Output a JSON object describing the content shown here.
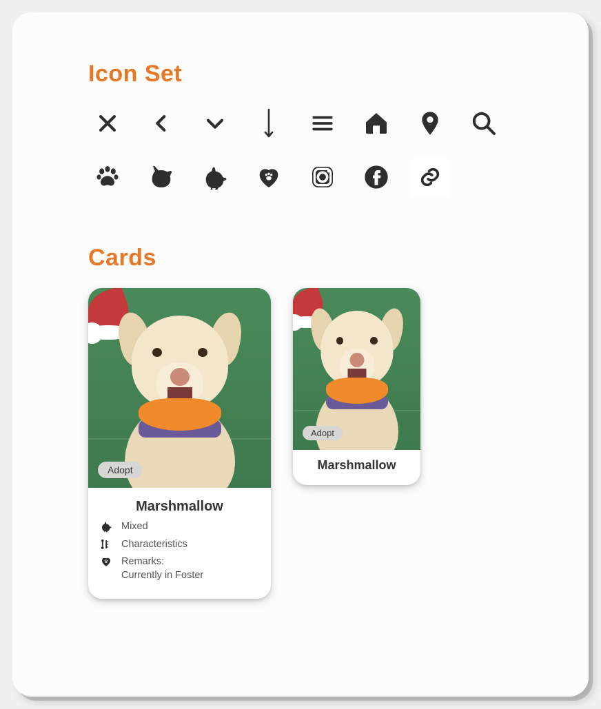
{
  "sections": {
    "icons_title": "Icon Set",
    "cards_title": "Cards"
  },
  "icons": [
    {
      "name": "close-icon"
    },
    {
      "name": "chevron-left-icon"
    },
    {
      "name": "chevron-down-icon"
    },
    {
      "name": "arrow-down-icon"
    },
    {
      "name": "menu-icon"
    },
    {
      "name": "home-icon"
    },
    {
      "name": "location-pin-icon"
    },
    {
      "name": "search-icon"
    },
    {
      "name": "paw-icon"
    },
    {
      "name": "cat-icon"
    },
    {
      "name": "dog-icon"
    },
    {
      "name": "heart-paw-icon"
    },
    {
      "name": "instagram-icon"
    },
    {
      "name": "facebook-icon"
    },
    {
      "name": "link-icon"
    }
  ],
  "cards": {
    "large": {
      "badge": "Adopt",
      "name": "Marshmallow",
      "meta": [
        {
          "icon": "dog-icon",
          "text": "Mixed"
        },
        {
          "icon": "bone-ruler-icon",
          "text": "Characteristics"
        },
        {
          "icon": "heart-paw-icon",
          "text": "Remarks:\nCurrently in Foster"
        }
      ]
    },
    "small": {
      "badge": "Adopt",
      "name": "Marshmallow"
    }
  }
}
